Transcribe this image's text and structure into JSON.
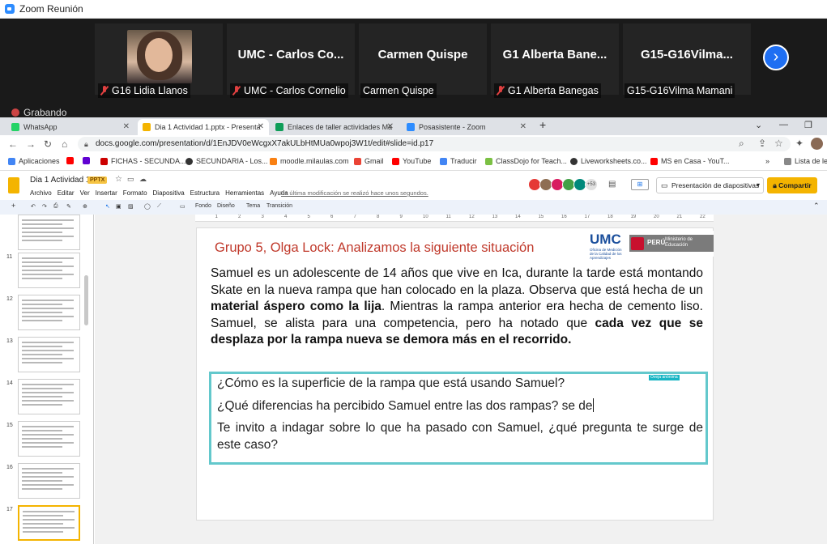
{
  "zoom": {
    "window_title": "Zoom Reunión",
    "participants": [
      {
        "label": "G16 Lidia Llanos",
        "muted": true,
        "has_video": true
      },
      {
        "display": "UMC - Carlos Co...",
        "label": "UMC - Carlos Cornelio",
        "muted": true
      },
      {
        "display": "Carmen Quispe",
        "label": "Carmen Quispe",
        "muted": false
      },
      {
        "display": "G1 Alberta Bane...",
        "label": "G1 Alberta Banegas",
        "muted": true
      },
      {
        "display": "G15-G16Vilma...",
        "label": "G15-G16Vilma Mamani",
        "muted": false
      }
    ],
    "recording_label": "Grabando"
  },
  "browser": {
    "tabs": [
      {
        "label": "WhatsApp",
        "icon_color": "#25d366"
      },
      {
        "label": "Dia 1 Actividad 1.pptx - Presenta",
        "icon_color": "#f4b400",
        "active": true
      },
      {
        "label": "Enlaces de taller actividades Ma",
        "icon_color": "#0f9d58"
      },
      {
        "label": "Posasistente - Zoom",
        "icon_color": "#2d8cff"
      }
    ],
    "new_tab": "+",
    "url": "docs.google.com/presentation/d/1EnJDV0eWcgxX7akULbHtMUa0wpoj3W1t/edit#slide=id.p17",
    "bookmarks": [
      {
        "label": "Aplicaciones",
        "icon_color": "#4285f4"
      },
      {
        "label": "",
        "icon_color": "#ff0000"
      },
      {
        "label": "",
        "icon_color": "#6001d2"
      },
      {
        "label": "FICHAS - SECUNDA...",
        "icon_color": "#c00"
      },
      {
        "label": "SECUNDARIA - Los...",
        "icon_color": "#333"
      },
      {
        "label": "moodle.milaulas.com",
        "icon_color": "#f98012"
      },
      {
        "label": "Gmail",
        "icon_color": "#ea4335"
      },
      {
        "label": "YouTube",
        "icon_color": "#ff0000"
      },
      {
        "label": "Traducir",
        "icon_color": "#4285f4"
      },
      {
        "label": "ClassDojo for Teach...",
        "icon_color": "#7bc043"
      },
      {
        "label": "Liveworksheets.co...",
        "icon_color": "#333"
      },
      {
        "label": "MS en Casa - YouT...",
        "icon_color": "#ff0000"
      }
    ],
    "more_bookmarks": "»",
    "reading_list": "Lista de lec"
  },
  "slides": {
    "doc_title": "Dia 1 Actividad 1",
    "badge": "PPTX",
    "menus": [
      "Archivo",
      "Editar",
      "Ver",
      "Insertar",
      "Formato",
      "Diapositiva",
      "Estructura",
      "Herramientas",
      "Ayuda"
    ],
    "last_edit": "La última modificación se realizó hace unos segundos.",
    "collaborator_count": "+53",
    "present_button": "Presentación de diapositivas",
    "share_button": "Compartir",
    "toolbar": {
      "background": "Fondo",
      "layout": "Diseño",
      "theme": "Tema",
      "transition": "Transición"
    },
    "thumbnails": [
      {
        "num": "",
        "sel": false
      },
      {
        "num": "11",
        "sel": false
      },
      {
        "num": "12",
        "sel": false
      },
      {
        "num": "13",
        "sel": false
      },
      {
        "num": "14",
        "sel": false
      },
      {
        "num": "15",
        "sel": false
      },
      {
        "num": "16",
        "sel": false
      },
      {
        "num": "17",
        "sel": true
      }
    ]
  },
  "slide": {
    "title": "Grupo 5, Olga Lock: Analizamos la siguiente situación",
    "logo": {
      "umc": "UMC",
      "umc_sub": "Oficina de Medición de la Calidad de los Aprendizajes",
      "peru": "PERÚ",
      "ministry": "Ministerio de Educación"
    },
    "paragraph": {
      "p1": "Samuel es un adolescente de 14 años que vive en Ica, durante la tarde está montando Skate en la nueva  rampa que han colocado en la plaza. Observa que está hecha de un ",
      "b1": "material áspero como la lija",
      "p2": ". Mientras la rampa anterior era hecha de cemento liso. Samuel, se alista para una competencia, pero ha notado que ",
      "b2": "cada vez que se desplaza por la rampa nueva se demora más en el recorrido."
    },
    "questions": [
      "¿Cómo es la superficie de la rampa que está usando Samuel?",
      "¿Qué diferencias ha percibido Samuel  entre  las dos rampas? se de",
      "Te invito a indagar sobre lo que ha pasado con Samuel, ¿qué pregunta te surge de este caso?"
    ],
    "anon_tag": "Oveja anónima"
  }
}
